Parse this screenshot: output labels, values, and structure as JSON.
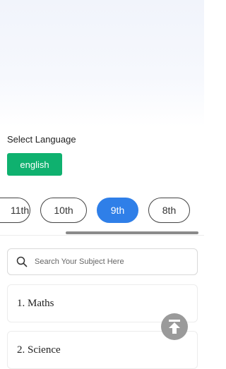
{
  "language": {
    "label": "Select Language",
    "selected": "english"
  },
  "classes": {
    "items": [
      {
        "label": "11th"
      },
      {
        "label": "10th"
      },
      {
        "label": "9th"
      },
      {
        "label": "8th"
      }
    ],
    "selected": "9th"
  },
  "search": {
    "placeholder": "Search Your Subject Here",
    "icon": "search-icon"
  },
  "subjects": [
    {
      "label": "1. Maths"
    },
    {
      "label": "2. Science"
    }
  ],
  "colors": {
    "language_button": "#0fb16f",
    "active_class": "#2f7fe8",
    "scroll_top_button": "#9a9a9a"
  },
  "scroll_top": {
    "icon": "arrow-up-to-top-icon"
  }
}
